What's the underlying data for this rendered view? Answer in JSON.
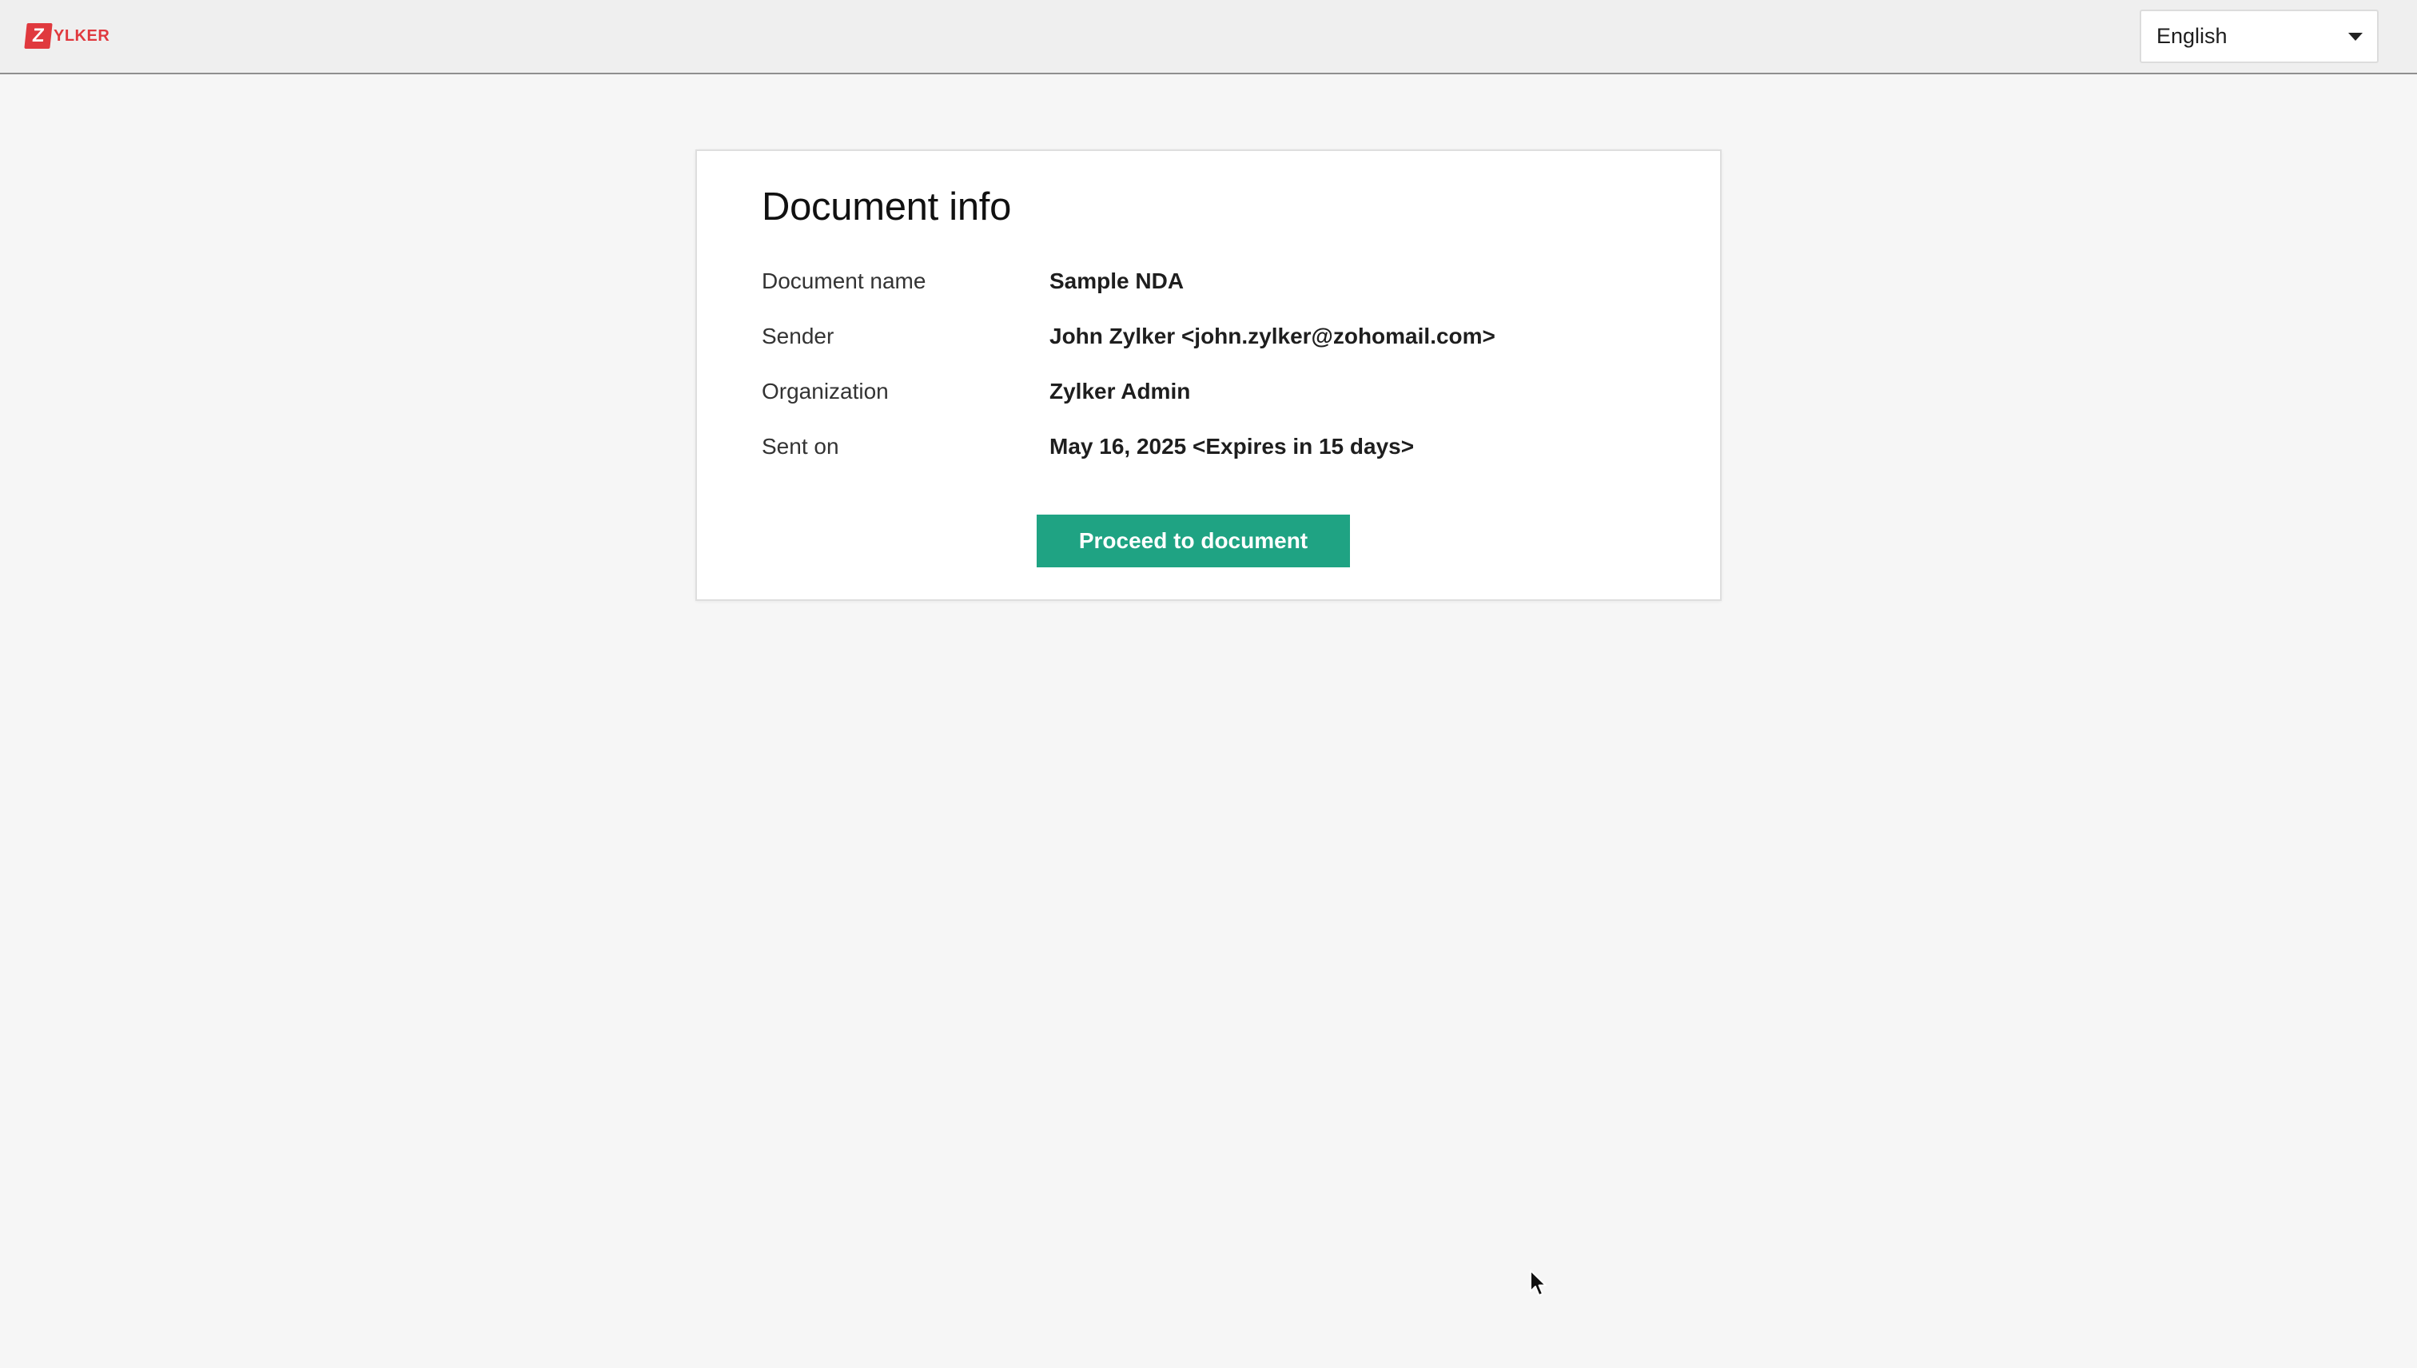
{
  "header": {
    "logo": {
      "mark_letter": "Z",
      "text": "YLKER",
      "brand_color": "#e0393e"
    },
    "language_select": {
      "selected": "English",
      "icon": "caret-down-icon"
    }
  },
  "card": {
    "title": "Document info",
    "rows": [
      {
        "label": "Document name",
        "value": "Sample NDA"
      },
      {
        "label": "Sender",
        "value": "John Zylker <john.zylker@zohomail.com>"
      },
      {
        "label": "Organization",
        "value": "Zylker Admin"
      },
      {
        "label": "Sent on",
        "value": "May 16, 2025 <Expires in 15 days>"
      }
    ],
    "proceed_button": {
      "label": "Proceed to document",
      "color": "#1fa383"
    }
  },
  "colors": {
    "page_background": "#f6f6f6",
    "header_background": "#efefef",
    "card_background": "#ffffff"
  }
}
